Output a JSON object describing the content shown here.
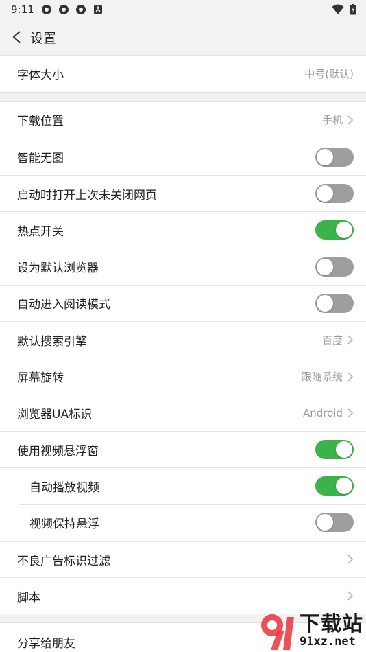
{
  "status": {
    "time": "9:11"
  },
  "header": {
    "title": "设置"
  },
  "group1": {
    "font_size_label": "字体大小",
    "font_size_value": "中号(默认)"
  },
  "rows": {
    "download_location": {
      "label": "下载位置",
      "value": "手机"
    },
    "smart_no_image": {
      "label": "智能无图",
      "state": "off"
    },
    "restore_pages": {
      "label": "启动时打开上次未关闭网页",
      "state": "off"
    },
    "hotspot": {
      "label": "热点开关",
      "state": "on"
    },
    "default_browser": {
      "label": "设为默认浏览器",
      "state": "off"
    },
    "reading_mode": {
      "label": "自动进入阅读模式",
      "state": "off"
    },
    "search_engine": {
      "label": "默认搜索引擎",
      "value": "百度"
    },
    "rotation": {
      "label": "屏幕旋转",
      "value": "跟随系统"
    },
    "ua": {
      "label": "浏览器UA标识",
      "value": "Android"
    },
    "floating_video": {
      "label": "使用视频悬浮窗",
      "state": "on"
    },
    "autoplay_video": {
      "label": "自动播放视频",
      "state": "on"
    },
    "keep_floating": {
      "label": "视频保持悬浮",
      "state": "off"
    },
    "ad_filter": {
      "label": "不良广告标识过滤"
    },
    "script": {
      "label": "脚本"
    }
  },
  "group3": {
    "share_label": "分享给朋友"
  },
  "watermark": {
    "cn": "下载站",
    "en": "91xz.net"
  },
  "colors": {
    "toggle_on": "#3cb34a",
    "toggle_off": "#9e9e9e",
    "background": "#f2f2f2"
  }
}
